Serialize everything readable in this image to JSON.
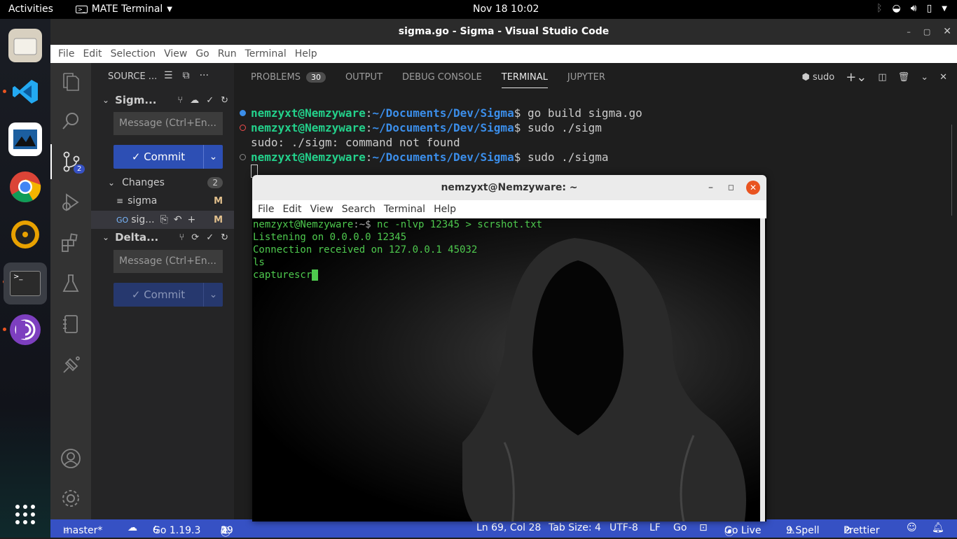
{
  "topbar": {
    "activities": "Activities",
    "app": "MATE Terminal",
    "clock": "Nov 18  10:02"
  },
  "vscode": {
    "title": "sigma.go - Sigma - Visual Studio Code",
    "menu": [
      "File",
      "Edit",
      "Selection",
      "View",
      "Go",
      "Run",
      "Terminal",
      "Help"
    ],
    "activity_badge": "2",
    "sidebar": {
      "header": "SOURCE ...",
      "repo1": "Sigm...",
      "message_placeholder": "Message (Ctrl+En...",
      "commit": "Commit",
      "changes": "Changes",
      "changes_count": "2",
      "file1": "sigma",
      "file1_status": "M",
      "file2": "sig...",
      "file2_status": "M",
      "repo2": "Delta...",
      "message2_placeholder": "Message (Ctrl+En...",
      "commit2": "Commit"
    },
    "panel": {
      "tabs": [
        "PROBLEMS",
        "OUTPUT",
        "DEBUG CONSOLE",
        "TERMINAL",
        "JUPYTER"
      ],
      "problems_count": "30",
      "shell": "sudo",
      "lines": [
        {
          "user": "nemzyxt@Nemzyware",
          "sep": ":",
          "path": "~/Documents/Dev/Sigma",
          "cmd": "$ go build sigma.go"
        },
        {
          "user": "nemzyxt@Nemzyware",
          "sep": ":",
          "path": "~/Documents/Dev/Sigma",
          "cmd": "$ sudo ./sigm"
        },
        {
          "plain": "sudo: ./sigm: command not found"
        },
        {
          "user": "nemzyxt@Nemzyware",
          "sep": ":",
          "path": "~/Documents/Dev/Sigma",
          "cmd": "$ sudo ./sigma"
        }
      ]
    },
    "status": {
      "branch": "master*",
      "go": "Go 1.19.3",
      "errors": "0",
      "warnings": "1",
      "info": "29",
      "position": "Ln 69, Col 28",
      "tab": "Tab Size: 4",
      "enc": "UTF-8",
      "eol": "LF",
      "lang": "Go",
      "live": "Go Live",
      "spell": "9 Spell",
      "prettier": "Prettier"
    }
  },
  "mate": {
    "title": "nemzyxt@Nemzyware: ~",
    "menu": [
      "File",
      "Edit",
      "View",
      "Search",
      "Terminal",
      "Help"
    ],
    "prompt_user": "nemzyxt@Nemzyware",
    "prompt_path": ":~$ ",
    "prompt_cmd": "nc -nlvp 12345 > scrshot.txt",
    "out": [
      "Listening on 0.0.0.0 12345",
      "Connection received on 127.0.0.1 45032",
      "ls",
      "capturescr"
    ]
  },
  "colors": {
    "statusbar": "#3651c4",
    "commit": "#2d4fb4",
    "user": "#23d18b",
    "path": "#3b8eea"
  }
}
